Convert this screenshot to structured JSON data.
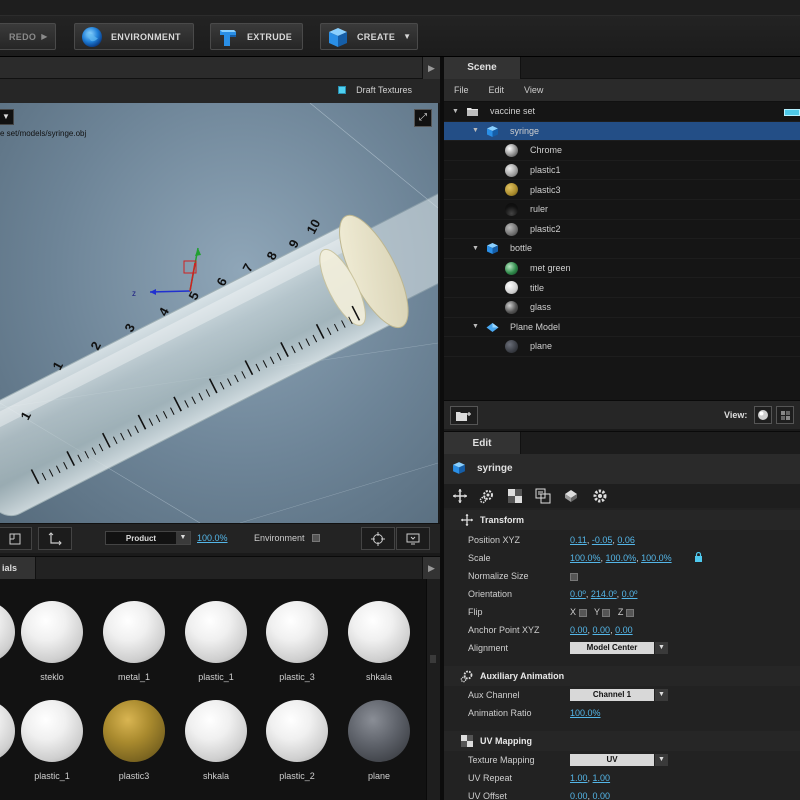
{
  "toolbar": {
    "redo_label": "REDO",
    "environment_label": "ENVIRONMENT",
    "extrude_label": "EXTRUDE",
    "create_label": "CREATE"
  },
  "viewport": {
    "draft_textures_label": "Draft Textures",
    "model_path": "e set/models/syringe.obj",
    "camera_mode": "Product",
    "zoom": "100.0%",
    "environment_label": "Environment",
    "syringe_marks": [
      "1",
      "2",
      "3",
      "4",
      "5",
      "6",
      "7",
      "8",
      "9",
      "10"
    ],
    "axis_label_z": "z"
  },
  "materials": {
    "tab_label": "ials",
    "row1": [
      "steklo",
      "metal_1",
      "plastic_1",
      "plastic_3",
      "shkala"
    ],
    "row2": [
      "plastic_1",
      "plastic3",
      "shkala",
      "plastic_2",
      "plane"
    ]
  },
  "scene": {
    "tab_label": "Scene",
    "menu": [
      "File",
      "Edit",
      "View"
    ],
    "tree": [
      {
        "label": "vaccine set",
        "level": 0,
        "type": "folder"
      },
      {
        "label": "syringe",
        "level": 1,
        "type": "model",
        "selected": true
      },
      {
        "label": "Chrome",
        "level": 2,
        "type": "material"
      },
      {
        "label": "plastic1",
        "level": 2,
        "type": "material"
      },
      {
        "label": "plastic3",
        "level": 2,
        "type": "material"
      },
      {
        "label": "ruler",
        "level": 2,
        "type": "material"
      },
      {
        "label": "plastic2",
        "level": 2,
        "type": "material"
      },
      {
        "label": "bottle",
        "level": 1,
        "type": "model"
      },
      {
        "label": "met green",
        "level": 2,
        "type": "material"
      },
      {
        "label": "title",
        "level": 2,
        "type": "material"
      },
      {
        "label": "glass",
        "level": 2,
        "type": "material"
      },
      {
        "label": "Plane Model",
        "level": 1,
        "type": "plane"
      },
      {
        "label": "plane",
        "level": 2,
        "type": "material"
      }
    ],
    "view_label": "View:"
  },
  "edit": {
    "tab_label": "Edit",
    "object_name": "syringe",
    "transform": {
      "title": "Transform",
      "position_label": "Position XYZ",
      "position": [
        "0.11",
        "-0.05",
        "0.06"
      ],
      "scale_label": "Scale",
      "scale": [
        "100.0%",
        "100.0%",
        "100.0%"
      ],
      "normalize_label": "Normalize Size",
      "orientation_label": "Orientation",
      "orientation": [
        "0.0º",
        "214.0º",
        "0.0º"
      ],
      "flip_label": "Flip",
      "flip_x": "X",
      "flip_y": "Y",
      "flip_z": "Z",
      "anchor_label": "Anchor Point XYZ",
      "anchor": [
        "0.00",
        "0.00",
        "0.00"
      ],
      "alignment_label": "Alignment",
      "alignment": "Model Center"
    },
    "aux": {
      "title": "Auxiliary Animation",
      "channel_label": "Aux Channel",
      "channel": "Channel 1",
      "ratio_label": "Animation Ratio",
      "ratio": "100.0%"
    },
    "uv": {
      "title": "UV Mapping",
      "mapping_label": "Texture Mapping",
      "mapping": "UV",
      "repeat_label": "UV Repeat",
      "repeat": [
        "1.00",
        "1.00"
      ],
      "offset_label": "UV Offset",
      "offset": [
        "0.00",
        "0.00"
      ]
    }
  },
  "colors": {
    "accent": "#54b6e8",
    "selection": "#234e86",
    "toggle_on": "#4fd0f0"
  }
}
